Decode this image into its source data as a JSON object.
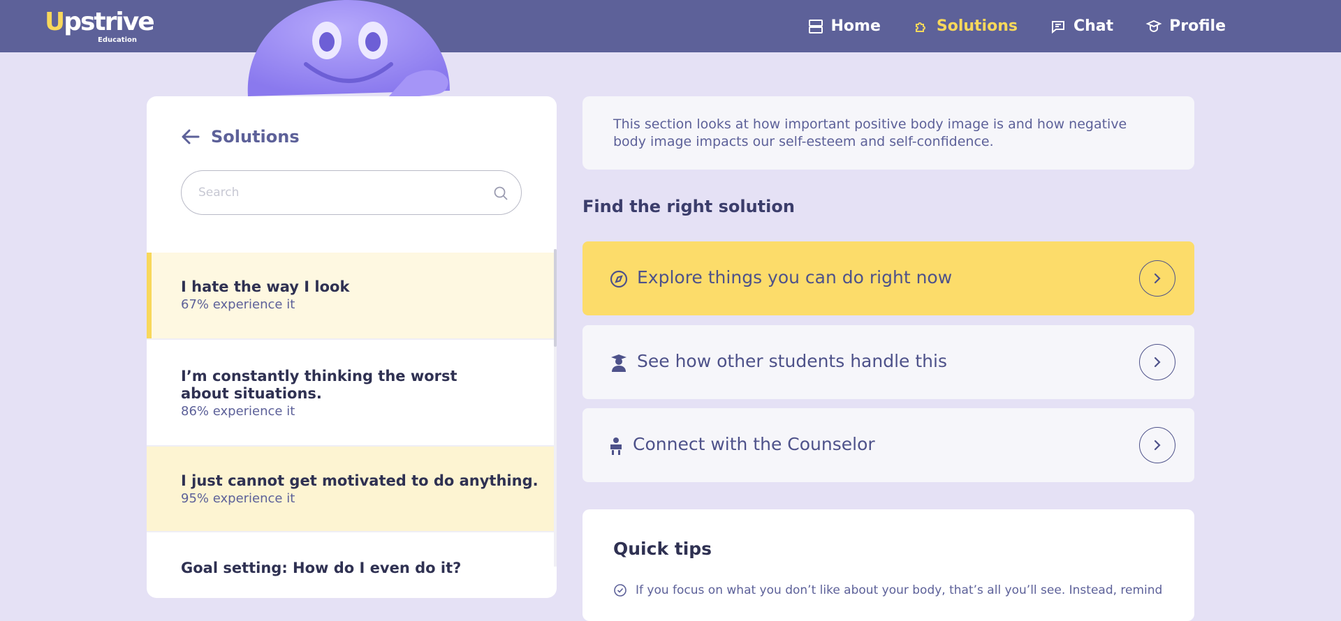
{
  "brand": {
    "name_u": "U",
    "name_rest": "pstrive",
    "sub": "Education"
  },
  "nav": [
    {
      "label": "Home"
    },
    {
      "label": "Solutions",
      "active": true
    },
    {
      "label": "Chat"
    },
    {
      "label": "Profile"
    }
  ],
  "left": {
    "back_label": "Solutions",
    "search_placeholder": "Search",
    "items": [
      {
        "title": "I hate the way I look",
        "sub": "67% experience it",
        "state": "selected"
      },
      {
        "title": "I’m constantly thinking the worst about situations.",
        "sub": "86% experience it",
        "state": "normal"
      },
      {
        "title": "I just cannot get motivated to do anything.",
        "sub": "95% experience it",
        "state": "highlight"
      },
      {
        "title": "Goal setting: How do I even do it?",
        "sub": "",
        "state": "normal"
      }
    ]
  },
  "intro_text": "This section looks at how important positive body image is and how negative body image impacts our self-esteem and self-confidence.",
  "find_title": "Find the right solution",
  "options": [
    {
      "label": "Explore things you can do right now",
      "icon": "compass-icon"
    },
    {
      "label": "See how other students handle this",
      "icon": "student-icon"
    },
    {
      "label": "Connect with the Counselor",
      "icon": "counselor-icon"
    }
  ],
  "tips": {
    "title": "Quick tips",
    "items": [
      "If you focus on what you don’t like about your body, that’s all you’ll see. Instead, remind"
    ]
  },
  "colors": {
    "header": "#5d6199",
    "accent": "#f8d85b",
    "bg": "#e5e1f5"
  }
}
